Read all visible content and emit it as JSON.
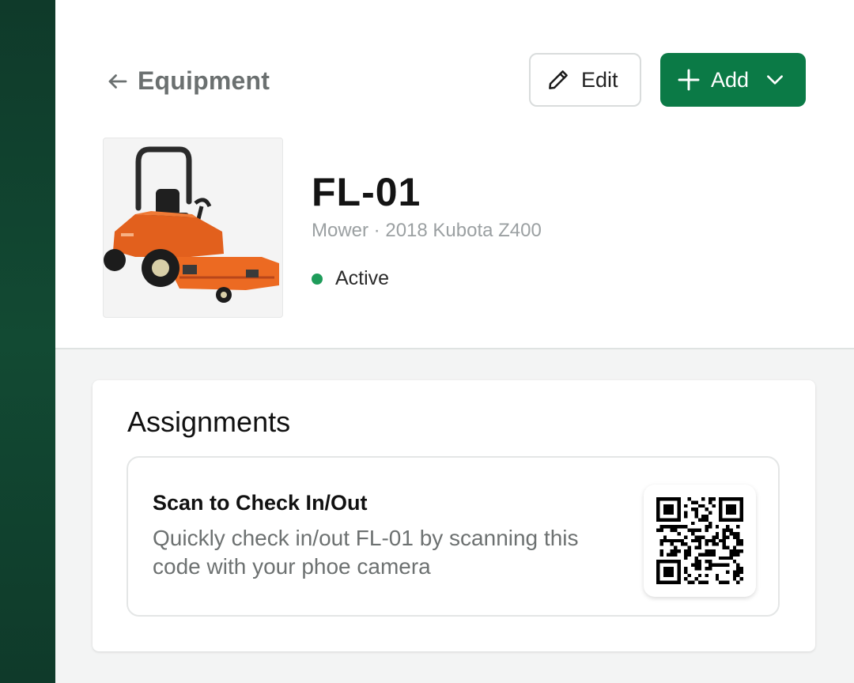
{
  "nav": {
    "back_label": "Equipment"
  },
  "toolbar": {
    "edit_label": "Edit",
    "add_label": "Add"
  },
  "equipment": {
    "name": "FL-01",
    "subtitle": "Mower · 2018 Kubota Z400",
    "status": "Active",
    "status_color": "#1e9c5a",
    "image_subject": "orange zero-turn mower"
  },
  "assignments": {
    "heading": "Assignments",
    "scan": {
      "title": "Scan to Check In/Out",
      "description": "Quickly check in/out FL-01 by scanning this code with your phoe camera",
      "icon": "qr-code-icon"
    }
  },
  "colors": {
    "sidebar": "#124a33",
    "primary": "#0b7a46"
  }
}
